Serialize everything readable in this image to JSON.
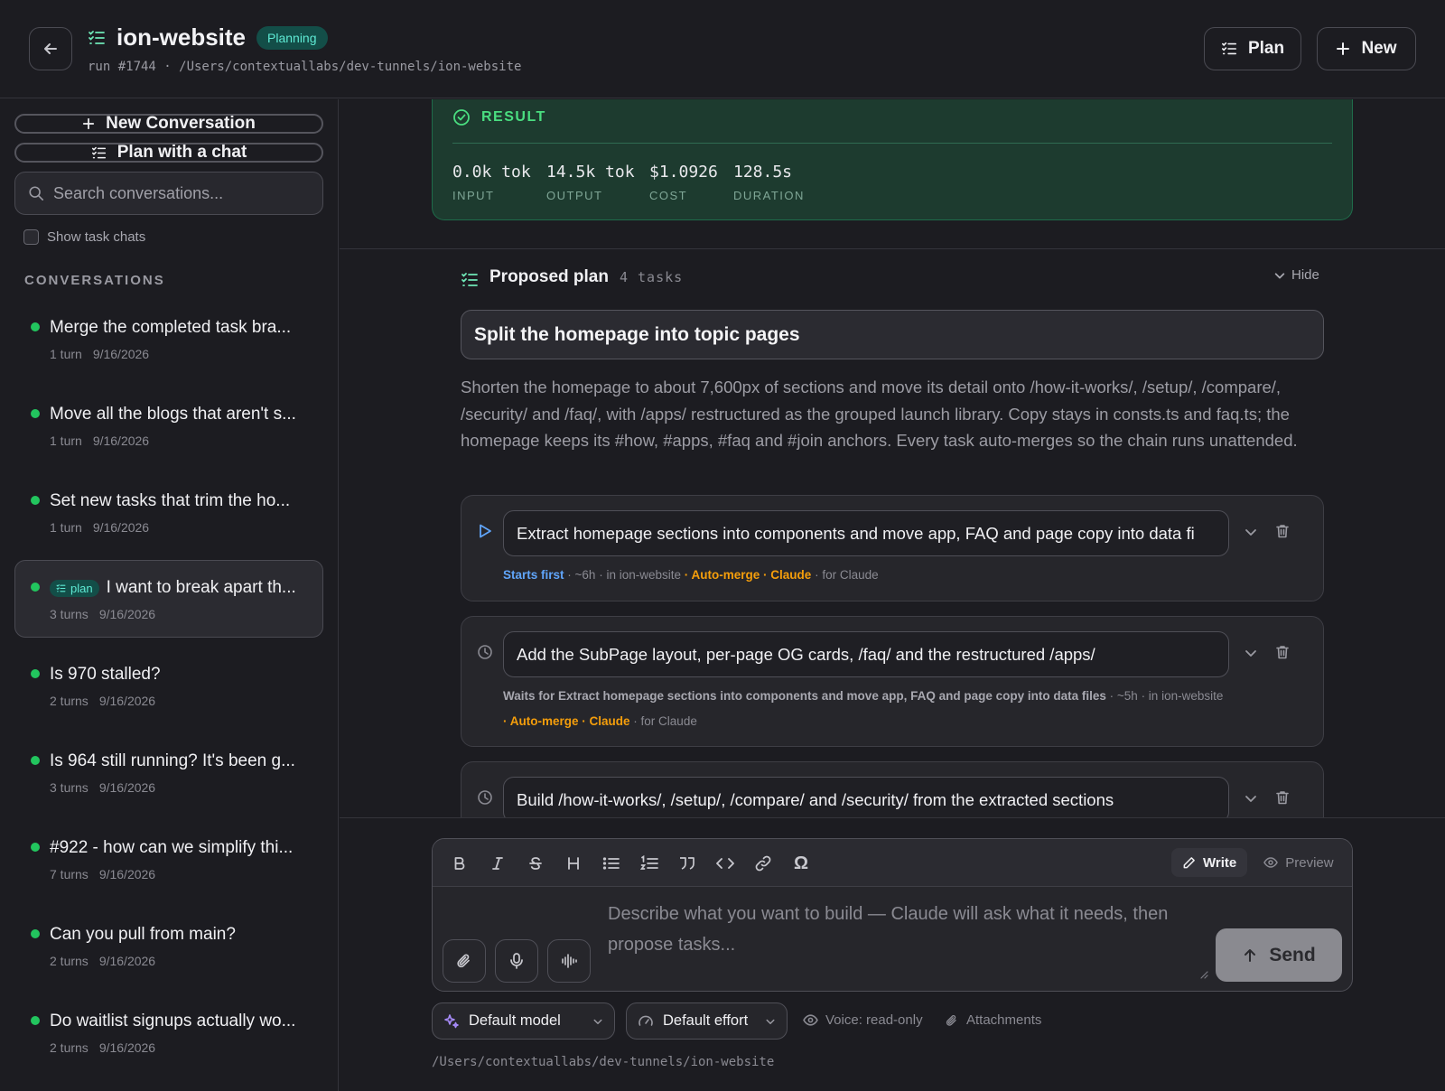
{
  "header": {
    "title": "ion-website",
    "status": "Planning",
    "run_path": "run #1744 · /Users/contextuallabs/dev-tunnels/ion-website",
    "plan_label": "Plan",
    "new_label": "New"
  },
  "sidebar": {
    "new_conversation": "New Conversation",
    "plan_with_chat": "Plan with a chat",
    "search_placeholder": "Search conversations...",
    "show_task_chats": "Show task chats",
    "heading": "CONVERSATIONS",
    "items": [
      {
        "title": "Merge the completed task bra...",
        "turns": "1 turn",
        "date": "9/16/2026"
      },
      {
        "title": "Move all the blogs that aren't s...",
        "turns": "1 turn",
        "date": "9/16/2026"
      },
      {
        "title": "Set new tasks that trim the ho...",
        "turns": "1 turn",
        "date": "9/16/2026"
      },
      {
        "title": "I want to break apart th...",
        "tag": "plan",
        "turns": "3 turns",
        "date": "9/16/2026"
      },
      {
        "title": "Is 970 stalled?",
        "turns": "2 turns",
        "date": "9/16/2026"
      },
      {
        "title": "Is 964 still running? It's been g...",
        "turns": "3 turns",
        "date": "9/16/2026"
      },
      {
        "title": "#922 - how can we simplify thi...",
        "turns": "7 turns",
        "date": "9/16/2026"
      },
      {
        "title": "Can you pull from main?",
        "turns": "2 turns",
        "date": "9/16/2026"
      },
      {
        "title": "Do waitlist signups actually wo...",
        "turns": "2 turns",
        "date": "9/16/2026"
      }
    ]
  },
  "result": {
    "heading": "RESULT",
    "stats": [
      {
        "value": "0.0k tok",
        "label": "INPUT"
      },
      {
        "value": "14.5k tok",
        "label": "OUTPUT"
      },
      {
        "value": "$1.0926",
        "label": "COST"
      },
      {
        "value": "128.5s",
        "label": "DURATION"
      }
    ]
  },
  "plan": {
    "heading": "Proposed plan",
    "count": "4 tasks",
    "hide_label": "Hide",
    "title": "Split the homepage into topic pages",
    "description": "Shorten the homepage to about 7,600px of sections and move its detail onto /how-it-works/, /setup/, /compare/, /security/ and /faq/, with /apps/ restructured as the grouped launch library. Copy stays in consts.ts and faq.ts; the homepage keeps its #how, #apps, #faq and #join anchors. Every task auto-merges so the chain runs unattended.",
    "tasks": [
      {
        "title": "Extract homepage sections into components and move app, FAQ and page copy into data fi",
        "order": "Starts first",
        "estimate": "· ~6h",
        "repo": "· in ion-website",
        "automerge": "· Auto-merge",
        "agent": "· Claude",
        "for": "· for Claude"
      },
      {
        "title": "Add the SubPage layout, per-page OG cards, /faq/ and the restructured /apps/",
        "order": "Waits for Extract homepage sections into components and move app, FAQ and page copy into data files",
        "estimate": "· ~5h",
        "repo": "· in ion-website",
        "automerge": "· Auto-merge",
        "agent": "· Claude",
        "for": "· for Claude"
      },
      {
        "title": "Build /how-it-works/, /setup/, /compare/ and /security/ from the extracted sections"
      }
    ]
  },
  "composer": {
    "write_label": "Write",
    "preview_label": "Preview",
    "placeholder": "Describe what you want to build — Claude will ask what it needs, then propose tasks...",
    "send_label": "Send",
    "model": "Default model",
    "effort": "Default effort",
    "voice": "Voice: read-only",
    "attachments": "Attachments",
    "cwd": "/Users/contextuallabs/dev-tunnels/ion-website"
  },
  "colors": {
    "background": "#1c1c21",
    "accent_teal": "#5eead4",
    "success_green": "#22c55e",
    "link_blue": "#60a5fa",
    "amber": "#f59e0b"
  },
  "icons": [
    "back-arrow-icon",
    "checklist-icon",
    "plus-icon",
    "search-icon",
    "check-circle-icon",
    "chevron-down-icon",
    "play-icon",
    "clock-icon",
    "trash-icon",
    "bold-icon",
    "italic-icon",
    "strikethrough-icon",
    "heading-icon",
    "bullet-list-icon",
    "numbered-list-icon",
    "quote-icon",
    "code-icon",
    "link-icon",
    "omega-icon",
    "pencil-icon",
    "eye-icon",
    "paperclip-icon",
    "mic-icon",
    "waveform-icon",
    "arrow-up-icon",
    "sparkle-icon",
    "gauge-icon"
  ]
}
